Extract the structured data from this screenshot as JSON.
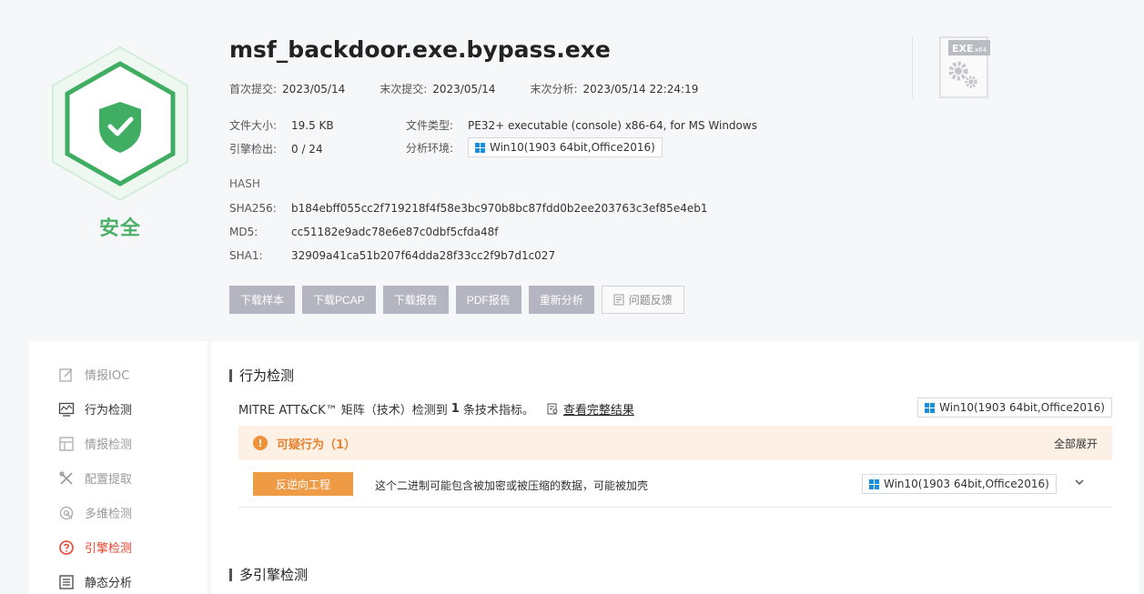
{
  "file": {
    "name": "msf_backdoor.exe.bypass.exe",
    "verdict": "安全",
    "first_submit_label": "首次提交:",
    "first_submit": "2023/05/14",
    "last_submit_label": "末次提交:",
    "last_submit": "2023/05/14",
    "last_analysis_label": "末次分析:",
    "last_analysis": "2023/05/14 22:24:19",
    "size_label": "文件大小:",
    "size": "19.5 KB",
    "type_label": "文件类型:",
    "type": "PE32+ executable (console) x86-64, for MS Windows",
    "engines_label": "引擎检出:",
    "engines": "0 / 24",
    "env_label": "分析环境:",
    "env": "Win10(1903 64bit,Office2016)",
    "file_icon_text": "EXE",
    "file_icon_sub": "x64"
  },
  "hash": {
    "title": "HASH",
    "sha256_label": "SHA256:",
    "sha256": "b184ebff055cc2f719218f4f58e3bc970b8bc87fdd0b2ee203763c3ef85e4eb1",
    "md5_label": "MD5:",
    "md5": "cc51182e9adc78e6e87c0dbf5cfda48f",
    "sha1_label": "SHA1:",
    "sha1": "32909a41ca51b207f64dda28f33cc2f9b7d1c027"
  },
  "actions": {
    "download_sample": "下载样本",
    "download_pcap": "下载PCAP",
    "download_report": "下载报告",
    "pdf_report": "PDF报告",
    "reanalyze": "重新分析",
    "feedback": "问题反馈"
  },
  "sidebar": {
    "items": [
      {
        "label": "情报IOC",
        "icon": "edit-icon"
      },
      {
        "label": "行为检测",
        "icon": "monitor-chart-icon"
      },
      {
        "label": "情报检测",
        "icon": "layout-icon"
      },
      {
        "label": "配置提取",
        "icon": "tools-icon"
      },
      {
        "label": "多维检测",
        "icon": "radar-icon"
      },
      {
        "label": "引擎检测",
        "icon": "question-circle-icon"
      },
      {
        "label": "静态分析",
        "icon": "list-icon"
      }
    ]
  },
  "behavior": {
    "title": "行为检测",
    "mitre_prefix": "MITRE ATT&CK™ 矩阵（技术）检测到",
    "mitre_count": "1",
    "mitre_suffix": "条技术指标。",
    "full_link": "查看完整结果",
    "env": "Win10(1903 64bit,Office2016)",
    "suspicious_title": "可疑行为（1）",
    "expand_all": "全部展开",
    "rule_tag": "反逆向工程",
    "rule_desc": "这个二进制可能包含被加密或被压缩的数据，可能被加壳",
    "rule_env": "Win10(1903 64bit,Office2016)"
  },
  "multi_engine": {
    "title": "多引擎检测"
  },
  "colors": {
    "safe_green": "#4caf6a",
    "active_red": "#e8402a",
    "warn_orange": "#f0913a",
    "tag_orange": "#ef9a45",
    "button_gray": "#b3b6c0"
  }
}
